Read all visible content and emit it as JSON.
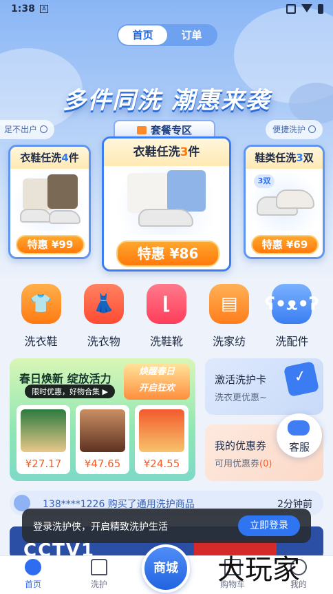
{
  "status_bar": {
    "time": "1:38",
    "a_badge": "A"
  },
  "header": {
    "tabs": [
      {
        "label": "首页",
        "active": true
      },
      {
        "label": "订单",
        "active": false
      }
    ]
  },
  "hero": {
    "slogan": "多件同洗  潮惠来袭",
    "package_tab": "套餐专区",
    "left_tag": "足不出户",
    "right_tag": "便捷洗护"
  },
  "packages": [
    {
      "title_pre": "衣鞋任洗",
      "count": "4",
      "title_post": "件",
      "price_label": "特惠",
      "price": "¥99"
    },
    {
      "title_pre": "衣鞋任洗",
      "count": "3",
      "title_post": "件",
      "price_label": "特惠",
      "price": "¥86"
    },
    {
      "title_pre": "鞋类任洗",
      "count": "3",
      "title_post": "双",
      "price_label": "特惠",
      "price": "¥69",
      "badge": "3双"
    }
  ],
  "categories": [
    {
      "label": "洗衣鞋",
      "icon": "shirt-shoe-icon",
      "color": "#ff8a1c"
    },
    {
      "label": "洗衣物",
      "icon": "dress-icon",
      "color": "#ff5a3a"
    },
    {
      "label": "洗鞋靴",
      "icon": "boot-icon",
      "color": "#ff4d6a"
    },
    {
      "label": "洗家纺",
      "icon": "bed-icon",
      "color": "#ff8f2b"
    },
    {
      "label": "洗配件",
      "icon": "bear-icon",
      "color": "#4c8ff5"
    }
  ],
  "promo": {
    "title": "春日焕新 绽放活力",
    "pill": "限时优惠，好物合集 ▶",
    "badge_line1": "焕醒春日",
    "badge_line2": "开启狂欢",
    "products": [
      {
        "price": "¥27.17"
      },
      {
        "price": "¥47.65"
      },
      {
        "price": "¥24.55"
      }
    ]
  },
  "activate_card": {
    "title": "激活洗护卡",
    "subtitle": "洗衣更优惠~"
  },
  "coupons": {
    "title": "我的优惠券",
    "subtitle": "可用优惠券",
    "count": "(0)"
  },
  "service": {
    "label": "客服"
  },
  "ticker": {
    "message": "138****1226 购买了通用洗护商品",
    "time": "2分钟前"
  },
  "banner": {
    "logo": "CCTV1"
  },
  "toast": {
    "message": "登录洗护侠，开启精致洗护生活",
    "button": "立即登录"
  },
  "tabbar": [
    {
      "label": "首页",
      "active": true
    },
    {
      "label": "洗护",
      "active": false
    },
    {
      "label": "商城",
      "active": false
    },
    {
      "label": "购物车",
      "active": false
    },
    {
      "label": "我的",
      "active": false
    }
  ],
  "watermark": "大玩家",
  "colors": {
    "primary": "#2f6df0",
    "price_orange": "#ff7a0c",
    "accent_blue": "#2f7cf6"
  }
}
